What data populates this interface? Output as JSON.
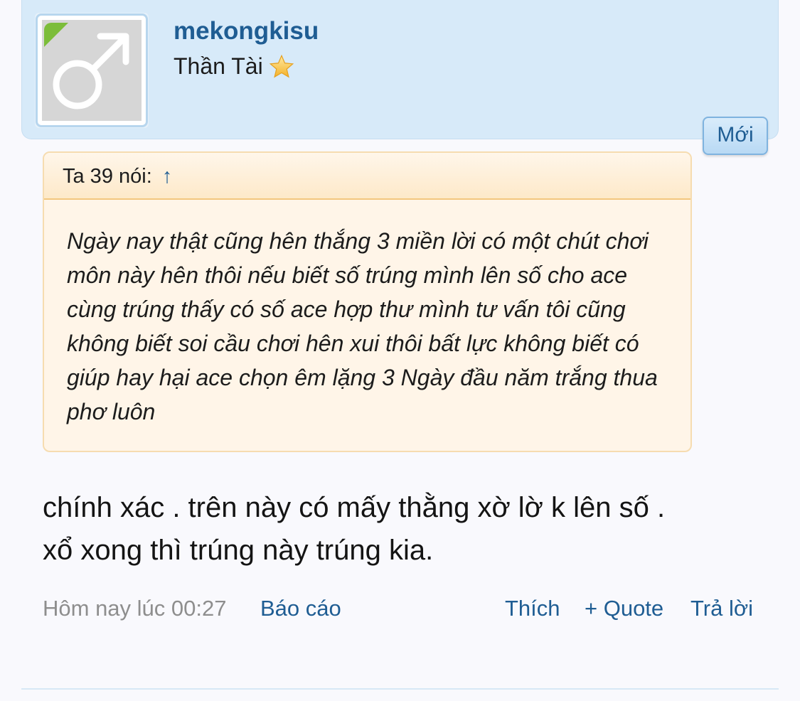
{
  "user": {
    "username": "mekongkisu",
    "title": "Thần Tài",
    "avatar_icon": "male-symbol-icon",
    "rank_icon": "star-icon",
    "status_badge": "Mới"
  },
  "quote": {
    "attribution": "Ta 39 nói:",
    "arrow": "↑",
    "text": "Ngày nay thật cũng hên thắng 3 miền lời có một chút chơi môn này hên thôi nếu biết số trúng mình lên số cho ace cùng trúng thấy có số ace hợp thư mình tư vấn tôi cũng không biết soi cầu chơi hên xui thôi bất lực không biết có giúp hay hại ace chọn êm lặng 3 Ngày đầu năm trắng thua phơ luôn"
  },
  "message": {
    "text": "chính xác . trên này có mấy thằng xờ lờ k lên số . xổ xong thì trúng này trúng kia."
  },
  "footer": {
    "timestamp": "Hôm nay lúc 00:27",
    "report": "Báo cáo",
    "like": "Thích",
    "quote": "+ Quote",
    "reply": "Trả lời"
  },
  "colors": {
    "link": "#1f5d93",
    "header_bg": "#d7eaf9",
    "quote_bg": "#fff5e8",
    "online": "#7cbd3a"
  }
}
